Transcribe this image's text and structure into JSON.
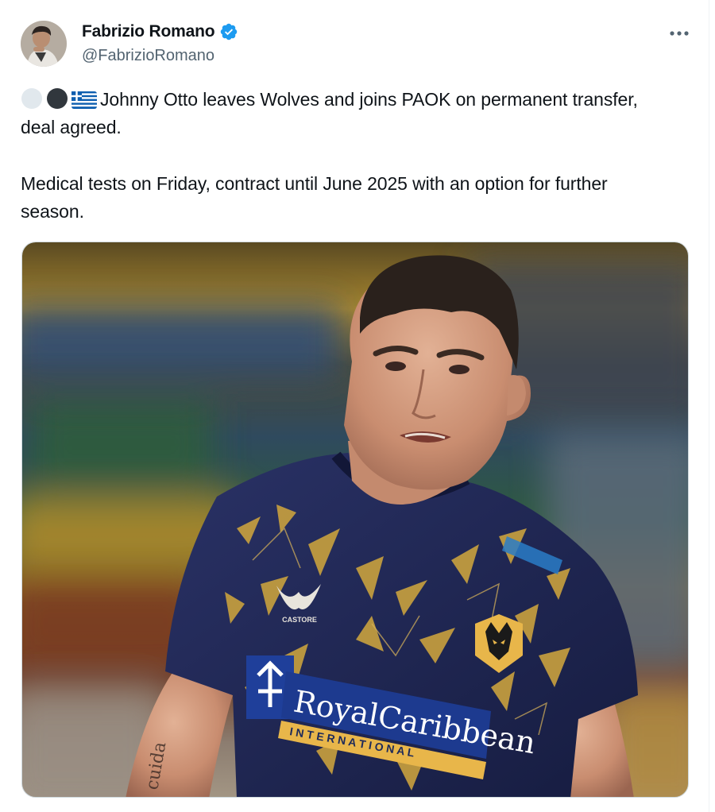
{
  "author": {
    "display_name": "Fabrizio Romano",
    "handle": "@FabrizioRomano",
    "verified": true,
    "verified_color": "#1d9bf0"
  },
  "tweet": {
    "emojis": [
      "white-circle-emoji",
      "black-circle-emoji",
      "greece-flag-emoji"
    ],
    "line1": "Johnny Otto leaves Wolves and joins PAOK on permanent transfer, deal agreed.",
    "line2": "Medical tests on Friday, contract until June 2025 with an option for further season."
  },
  "media": {
    "shirt_brand": "CASTORE",
    "sponsor_main": "RoyalCaribbean",
    "sponsor_sub": "I N T E R N A T I O N A L",
    "shirt_color": "#1f2856",
    "accent_color": "#e8b64a"
  },
  "icons": {
    "more": "more-horizontal-icon",
    "verified": "verified-badge-icon"
  }
}
